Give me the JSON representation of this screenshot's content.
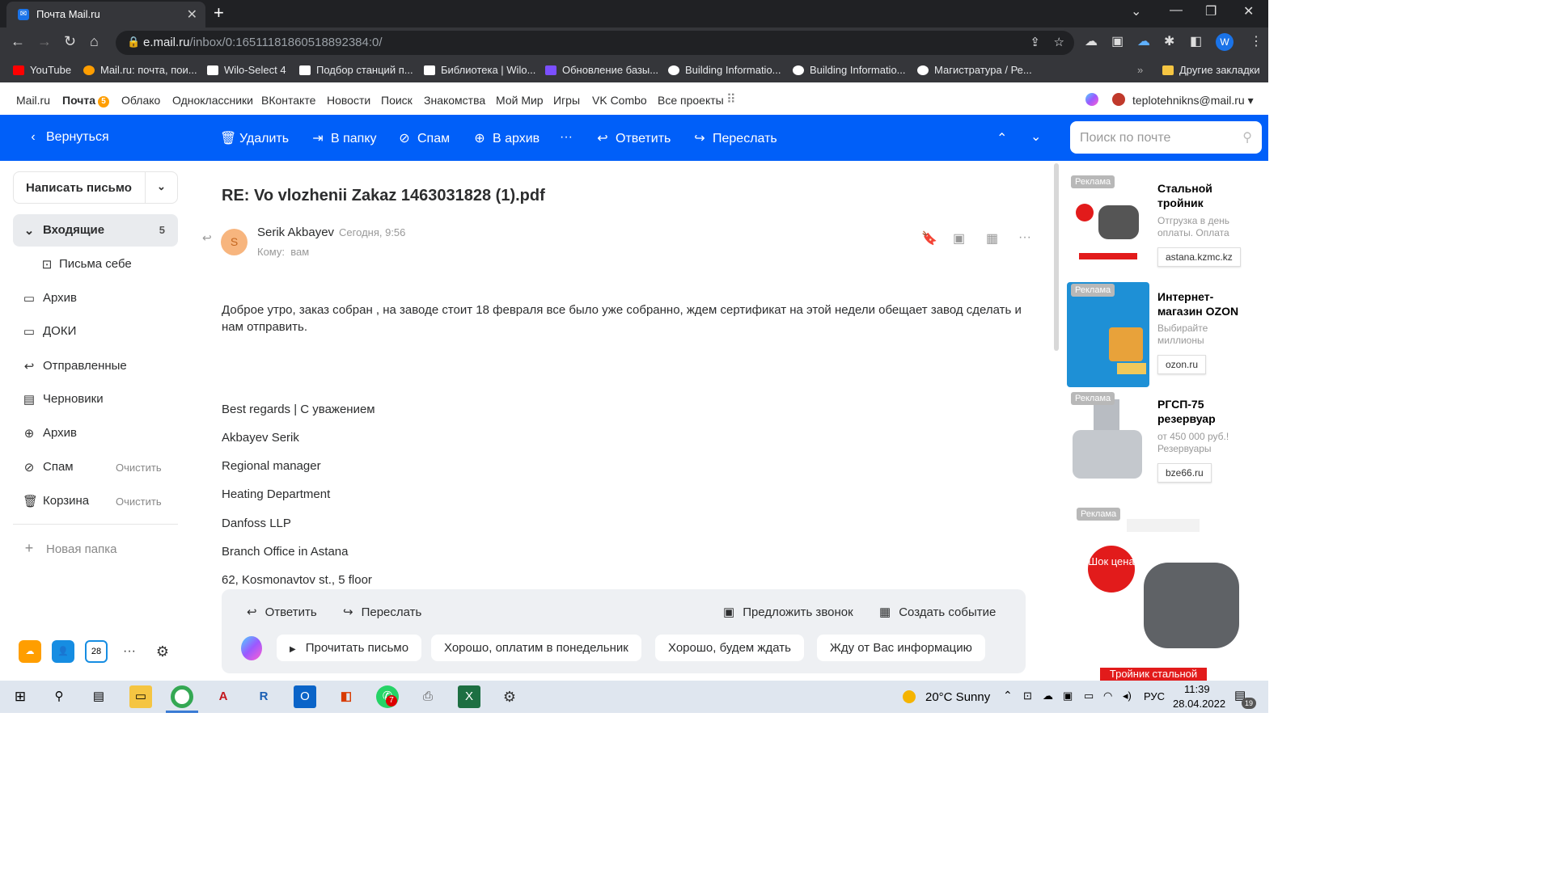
{
  "browser": {
    "tab_title": "Почта Mail.ru",
    "url_host": "e.mail.ru",
    "url_path": "/inbox/0:16511181860518892384:0/",
    "profile_initial": "W",
    "bookmarks": [
      {
        "label": "YouTube",
        "color": "#ff0000"
      },
      {
        "label": "Mail.ru: почта, пои...",
        "color": "#ff9e00"
      },
      {
        "label": "Wilo-Select 4",
        "color": "#ffffff"
      },
      {
        "label": "Подбор станций п...",
        "color": "#ffffff"
      },
      {
        "label": "Библиотека | Wilo...",
        "color": "#ffffff"
      },
      {
        "label": "Обновление базы...",
        "color": "#7b4fff"
      },
      {
        "label": "Building Informatio...",
        "color": "#ffffff"
      },
      {
        "label": "Building Informatio...",
        "color": "#ffffff"
      },
      {
        "label": "Магистратура / Ре...",
        "color": "#ffffff"
      }
    ],
    "other_bookmarks": "Другие закладки"
  },
  "portal": {
    "links": [
      "Mail.ru",
      "Почта",
      "Облако",
      "Одноклассники",
      "ВКонтакте",
      "Новости",
      "Поиск",
      "Знакомства",
      "Мой Мир",
      "Игры",
      "VK Combo",
      "Все проекты"
    ],
    "mail_badge": "5",
    "account": "teplotehnikns@mail.ru"
  },
  "toolbar": {
    "back": "Вернуться",
    "delete": "Удалить",
    "to_folder": "В папку",
    "spam": "Спам",
    "archive": "В архив",
    "more": "···",
    "reply": "Ответить",
    "forward": "Переслать",
    "search_placeholder": "Поиск по почте"
  },
  "sidebar": {
    "compose": "Написать письмо",
    "inbox": "Входящие",
    "inbox_count": "5",
    "to_self": "Письма себе",
    "archive1": "Архив",
    "docs": "ДОКИ",
    "sent": "Отправленные",
    "drafts": "Черновики",
    "archive2": "Архив",
    "spam": "Спам",
    "trash": "Корзина",
    "clear": "Очистить",
    "new_folder": "Новая папка",
    "calendar_day": "28"
  },
  "message": {
    "subject": "RE: Vo vlozhenii Zakaz 1463031828 (1).pdf",
    "sender": "Serik Akbayev",
    "avatar_letter": "S",
    "time": "Сегодня, 9:56",
    "to_label": "Кому:",
    "to_value": "вам",
    "body": "Доброе утро, заказ собран , на заводе стоит 18 февраля все было уже собранно, ждем сертификат на этой недели обещает завод сделать и нам отправить.",
    "signature": [
      "Best regards  |  С уважением",
      "Akbayev Serik",
      "Regional manager",
      "Heating Department",
      "Danfoss LLP",
      "Branch Office in Astana",
      "62, Kosmonavtov st., 5 floor"
    ]
  },
  "reply_panel": {
    "reply": "Ответить",
    "forward": "Переслать",
    "call": "Предложить звонок",
    "event": "Создать событие",
    "read": "Прочитать письмо",
    "chips": [
      "Хорошо, оплатим в понедельник",
      "Хорошо, будем ждать",
      "Жду от Вас информацию"
    ]
  },
  "ads": [
    {
      "tag": "Реклама",
      "title": "Стальной тройник",
      "desc": "Отгрузка в день оплаты. Оплата",
      "link": "astana.kzmc.kz"
    },
    {
      "tag": "Реклама",
      "title": "Интернет-магазин OZON",
      "desc": "Выбирайте миллионы",
      "link": "ozon.ru"
    },
    {
      "tag": "Реклама",
      "title": "РГСП-75 резервуар",
      "desc": "от 450 000 руб.! Резервуары",
      "link": "bze66.ru"
    }
  ],
  "big_ad": {
    "tag": "Реклама",
    "promo": "Шок цена",
    "caption": "Тройник стальной"
  },
  "taskbar": {
    "weather": "20°C  Sunny",
    "lang": "РУС",
    "time": "11:39",
    "date": "28.04.2022",
    "whatsapp_badge": "7",
    "notif_count": "19"
  }
}
